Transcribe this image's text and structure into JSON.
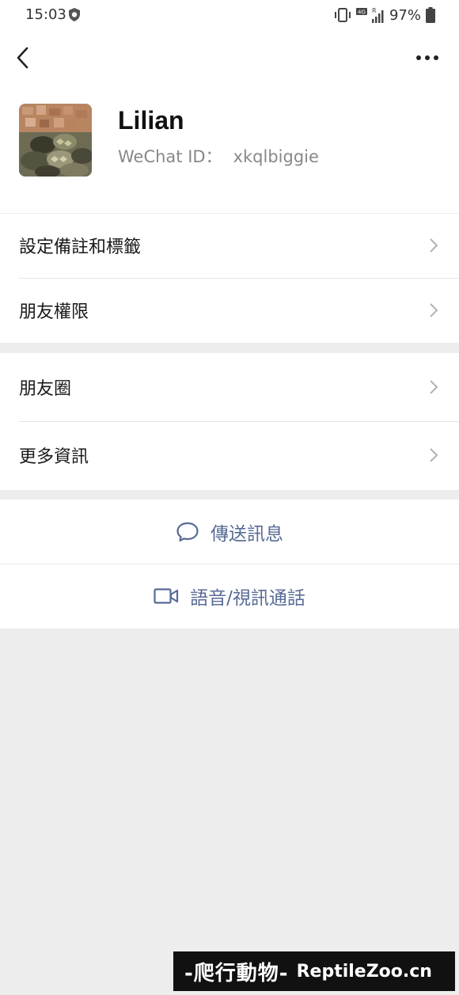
{
  "status_bar": {
    "time": "15:03",
    "network": "4G",
    "roaming": "R",
    "battery": "97%",
    "icons": [
      "shield-icon",
      "vibrate-icon",
      "signal-icon",
      "battery-icon"
    ]
  },
  "nav": {
    "back_icon": "back-chevron-icon",
    "more_icon": "more-dots-icon"
  },
  "profile": {
    "name": "Lilian",
    "id_label": "WeChat ID：",
    "id_value": "xkqlbiggie"
  },
  "menu": {
    "set_remark": "設定備註和標籤",
    "friend_permissions": "朋友權限",
    "moments": "朋友圈",
    "more_info": "更多資訊"
  },
  "actions": {
    "send_message": "傳送訊息",
    "voice_video_call": "語音/視訊通話"
  },
  "watermark": {
    "cn": "-爬行動物-",
    "en": "ReptileZoo.cn"
  },
  "colors": {
    "background": "#ededed",
    "surface": "#ffffff",
    "action_text": "#576b95",
    "secondary_text": "#888888"
  }
}
